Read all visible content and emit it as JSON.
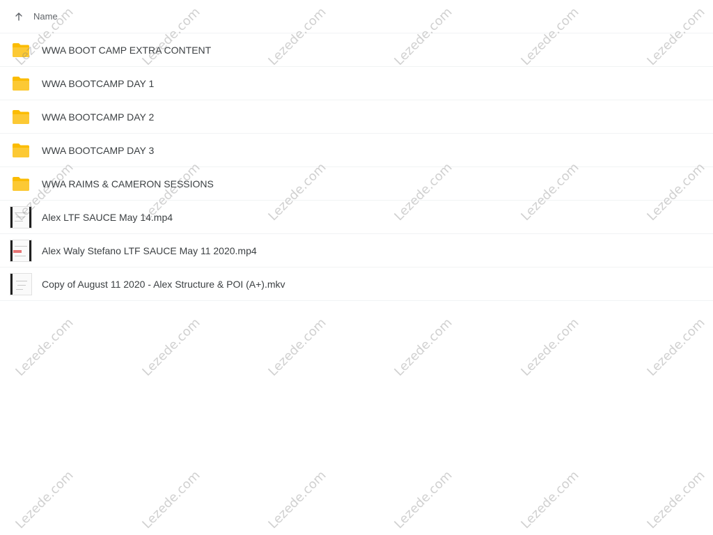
{
  "header": {
    "sort_icon": "arrow-up-icon",
    "column_label": "Name"
  },
  "files": [
    {
      "name": "WWA BOOT CAMP EXTRA CONTENT",
      "type": "folder",
      "icon": "folder-icon",
      "icon_color": "#FBBC04"
    },
    {
      "name": "WWA BOOTCAMP DAY 1",
      "type": "folder",
      "icon": "folder-icon",
      "icon_color": "#FBBC04"
    },
    {
      "name": "WWA BOOTCAMP DAY 2",
      "type": "folder",
      "icon": "folder-icon",
      "icon_color": "#FBBC04"
    },
    {
      "name": "WWA BOOTCAMP DAY 3",
      "type": "folder",
      "icon": "folder-icon",
      "icon_color": "#FBBC04"
    },
    {
      "name": "WWA RAIMS & CAMERON SESSIONS",
      "type": "folder",
      "icon": "folder-icon",
      "icon_color": "#FBBC04"
    },
    {
      "name": "Alex LTF SAUCE May 14.mp4",
      "type": "video",
      "icon": "video-thumbnail"
    },
    {
      "name": "Alex Waly Stefano LTF SAUCE May 11 2020.mp4",
      "type": "video",
      "icon": "video-thumbnail"
    },
    {
      "name": "Copy of August 11 2020 - Alex Structure & POI (A+).mkv",
      "type": "video",
      "icon": "video-thumbnail"
    }
  ],
  "watermark": {
    "text": "Lezede.com",
    "color": "#787878"
  }
}
